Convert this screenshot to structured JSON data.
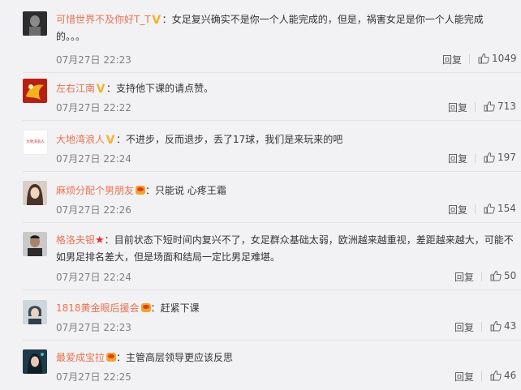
{
  "colors": {
    "username": "#eb7350",
    "text": "#333333",
    "time": "#808080",
    "vip_v": "#f6b02b",
    "background": "#f2f2f5"
  },
  "icons": {
    "like": "thumbs-up-icon",
    "verified": "v-badge-icon",
    "member": "crown-badge-icon",
    "star": "star-badge-icon"
  },
  "comments": [
    {
      "username": "可惜世界不及你好T_T",
      "badge": "v",
      "colon": "：",
      "content_line1": "女足复兴确实不是你一个人能完成的，但是，祸害女足是你一个人能完成",
      "content_line2": "的。。。",
      "time": "07月27日 22:23",
      "reply": "回复",
      "likes": "1049"
    },
    {
      "username": "左右江南",
      "badge": "v",
      "colon": "：",
      "content_line1": "支持他下课的请点赞。",
      "time": "07月27日 22:22",
      "reply": "回复",
      "likes": "713"
    },
    {
      "username": "大地湾浪人",
      "badge": "v",
      "colon": "：",
      "content_line1": "不进步，反而退步，丢了17球，我们是来玩来的吧",
      "avatar_text": "大地湾浪人",
      "time": "07月27日 22:24",
      "reply": "回复",
      "likes": "197"
    },
    {
      "username": "麻烦分配个男朋友",
      "badge": "crown",
      "colon": "：",
      "content_line1": "只能说 心疼王霜",
      "time": "07月27日 22:26",
      "reply": "回复",
      "likes": "154"
    },
    {
      "username": "格洛夫银",
      "badge": "star",
      "colon": "：",
      "content_line1": "目前状态下短时间内复兴不了，女足群众基础太弱，欧洲越来越重视，差距越来越大，可能不",
      "content_line2": "如男足排名差大，但是场面和结局一定比男足难堪。",
      "time": "07月27日 22:24",
      "reply": "回复",
      "likes": "50"
    },
    {
      "username": "1818黄金眼后援会",
      "badge": "crown",
      "colon": "：",
      "content_line1": "赶紧下课",
      "time": "07月27日 22:23",
      "reply": "回复",
      "likes": "43"
    },
    {
      "username": "最爱成宝拉",
      "badge": "crown",
      "colon": "：",
      "content_line1": "主管高层领导更应该反思",
      "time": "07月27日 22:25",
      "reply": "回复",
      "likes": "46"
    }
  ]
}
